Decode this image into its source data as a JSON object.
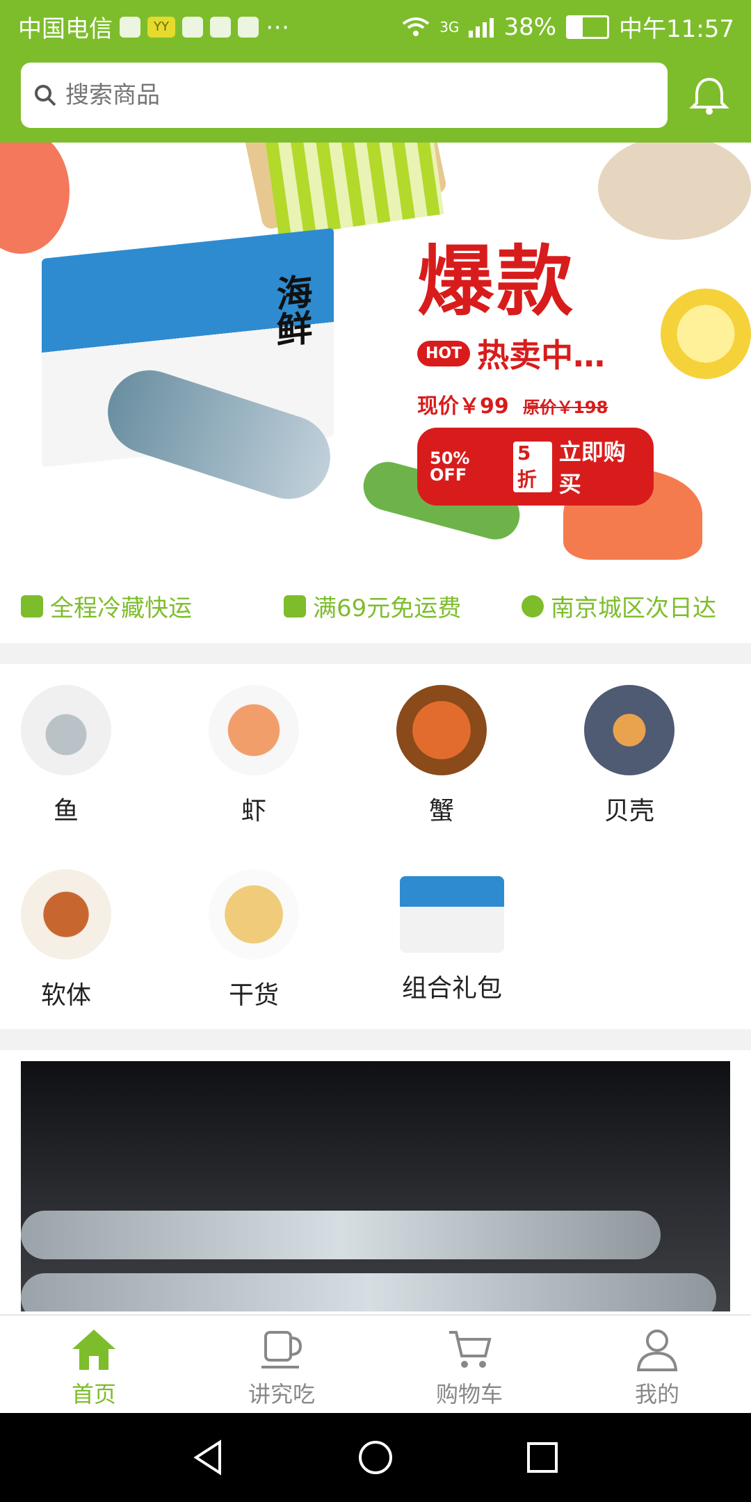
{
  "status_bar": {
    "carrier": "中国电信",
    "network": "3G",
    "battery": "38%",
    "time": "中午11:57",
    "notification_icons": [
      "sim-icon",
      "yy-icon",
      "app-icon",
      "app-icon",
      "avatar-icon",
      "more-icon"
    ]
  },
  "search": {
    "placeholder": "搜索商品"
  },
  "banner": {
    "box_text": "海鲜",
    "headline": "爆款",
    "hot_badge": "HOT",
    "hot_text": "热卖中…",
    "current_price": "现价￥99",
    "original_price": "原价￥198",
    "discount_percent": "50% OFF",
    "discount_zhe": "5折",
    "cta": "立即购买"
  },
  "benefits": [
    {
      "icon": "truck-icon",
      "label": "全程冷藏快运"
    },
    {
      "icon": "bag-icon",
      "label": "满69元免运费"
    },
    {
      "icon": "bolt-icon",
      "label": "南京城区次日达"
    }
  ],
  "categories": [
    {
      "label": "鱼"
    },
    {
      "label": "虾"
    },
    {
      "label": "蟹"
    },
    {
      "label": "贝壳"
    },
    {
      "label": "软体"
    },
    {
      "label": "干货"
    },
    {
      "label": "组合礼包"
    }
  ],
  "bottom_nav": [
    {
      "label": "首页",
      "active": true
    },
    {
      "label": "讲究吃",
      "active": false
    },
    {
      "label": "购物车",
      "active": false
    },
    {
      "label": "我的",
      "active": false
    }
  ],
  "colors": {
    "brand_green": "#7dbd2b",
    "promo_red": "#d81c1c"
  }
}
